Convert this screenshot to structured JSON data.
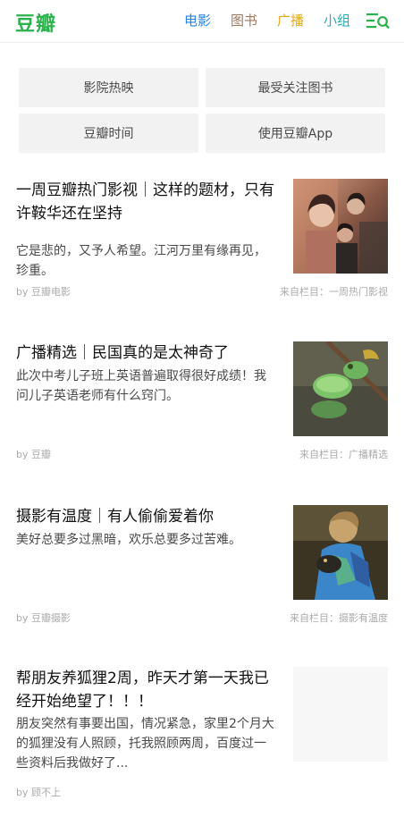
{
  "header": {
    "logo": "豆瓣",
    "nav": [
      "电影",
      "图书",
      "广播",
      "小组"
    ],
    "menu_icon": "menu-search-icon",
    "brand_color": "#2bb24c"
  },
  "quick_links": [
    "影院热映",
    "最受关注图书",
    "豆瓣时间",
    "使用豆瓣App"
  ],
  "feed": [
    {
      "title": "一周豆瓣热门影视｜这样的题材，只有许鞍华还在坚持",
      "desc": "它是悲的，又予人希望。江河万里有缘再见，珍重。",
      "author": "by 豆瓣电影",
      "source": "来自栏目：一周热门影视",
      "thumb": "movie-poster-image"
    },
    {
      "title": "广播精选｜民国真的是太神奇了",
      "desc": "此次中考儿子班上英语普遍取得很好成绩！我问儿子英语老师有什么窍门。",
      "author": "by 豆瓣",
      "source": "来自栏目：广播精选",
      "thumb": "lizard-image"
    },
    {
      "title": "摄影有温度｜有人偷偷爱着你",
      "desc": "美好总要多过黑暗，欢乐总要多过苦难。",
      "author": "by 豆瓣摄影",
      "source": "来自栏目：摄影有温度",
      "thumb": "child-cat-image"
    },
    {
      "title": "帮朋友养狐狸2周，昨天才第一天我已经开始绝望了！！！",
      "desc": "朋友突然有事要出国，情况紧急，家里2个月大的狐狸没有人照顾，托我照顾两周，百度过一些资料后我做好了...",
      "author": "by 顾不上",
      "source": "",
      "thumb": "fox-image-placeholder"
    }
  ]
}
